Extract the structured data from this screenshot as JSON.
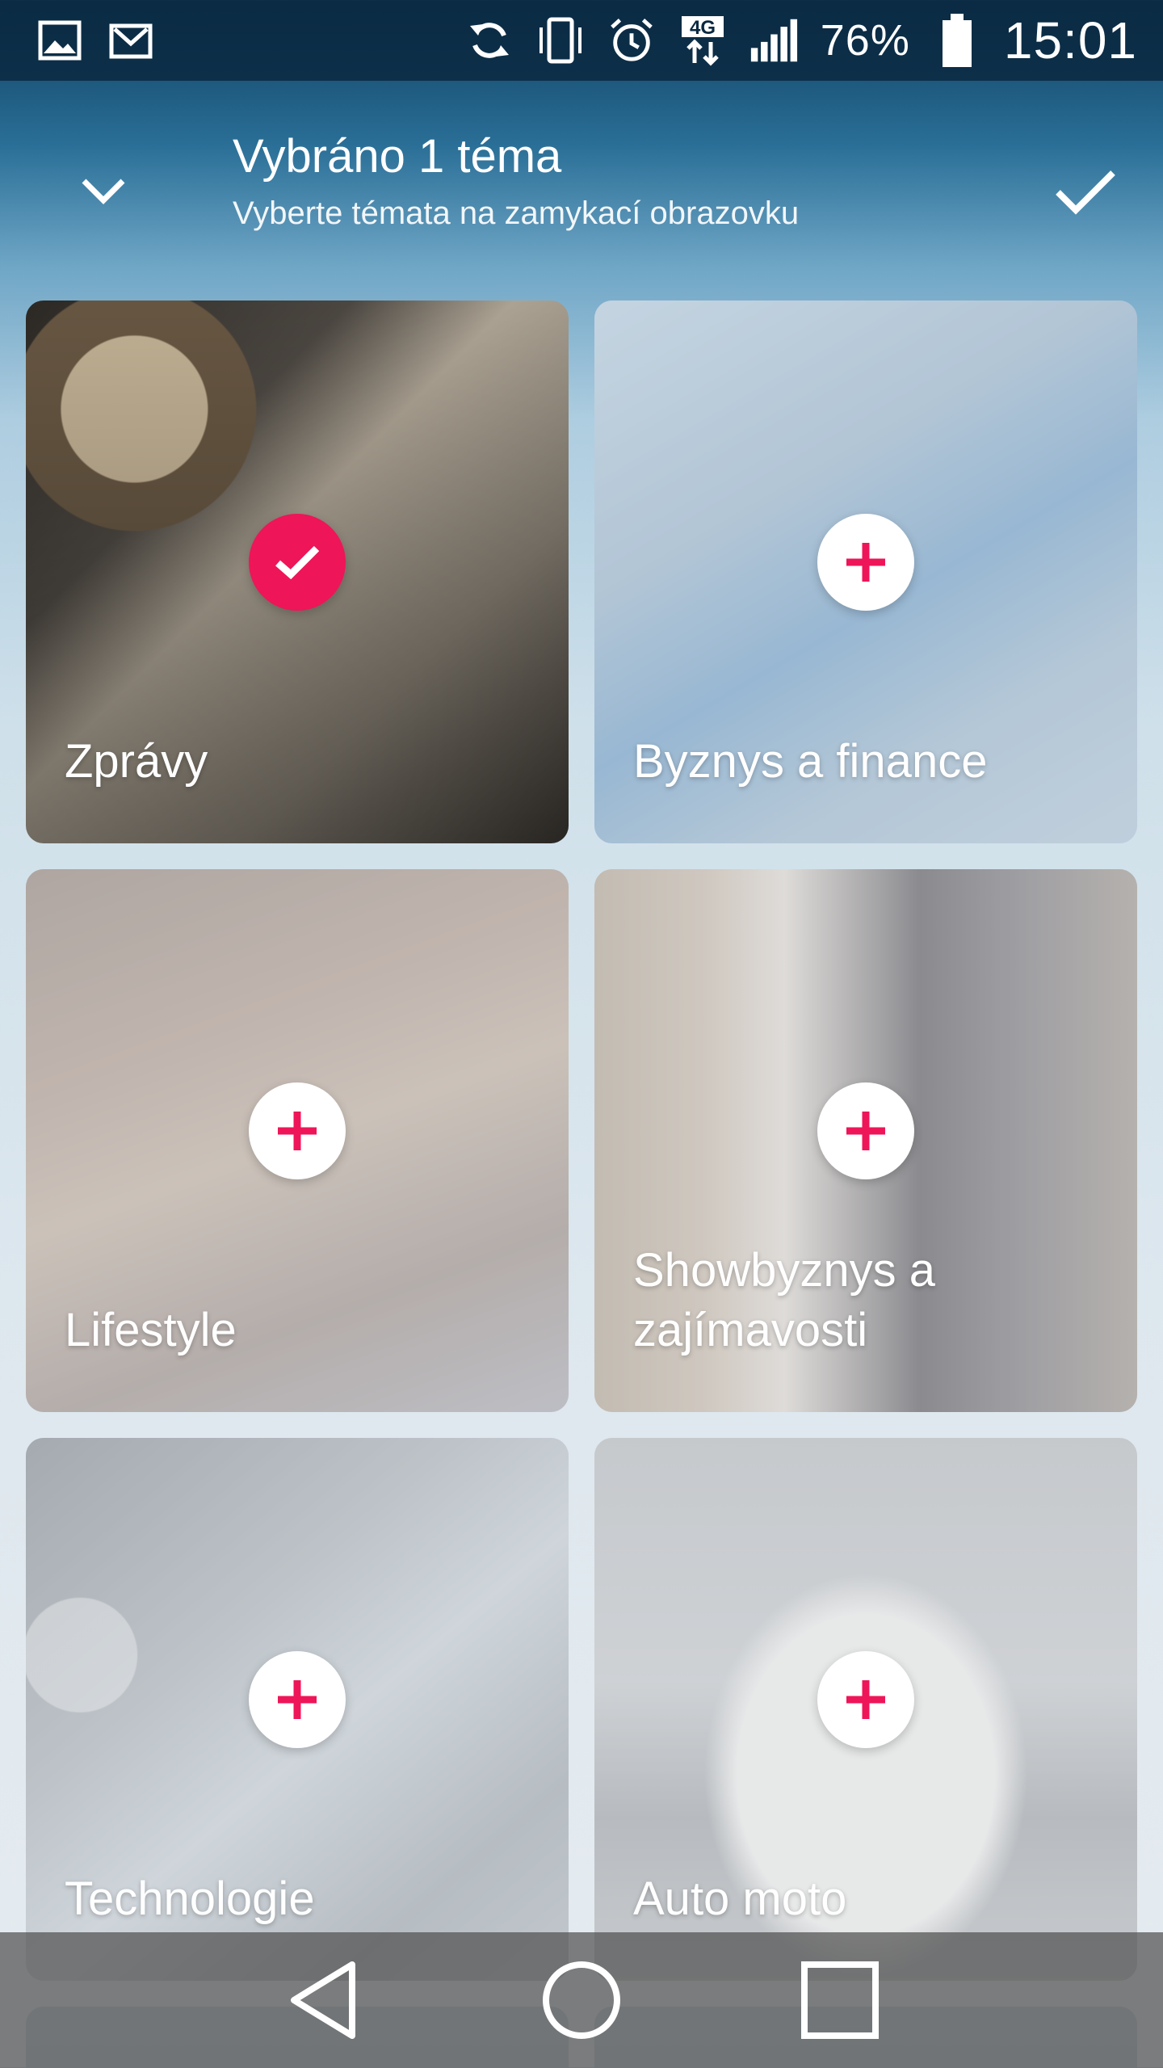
{
  "status_bar": {
    "left_icons": [
      "image-icon",
      "gmail-icon"
    ],
    "right_icons": [
      "sync-icon",
      "vibrate-icon",
      "alarm-icon",
      "4g-data-icon",
      "signal-icon"
    ],
    "network_label": "4G",
    "battery_percent": "76%",
    "time": "15:01"
  },
  "header": {
    "title": "Vybráno 1 téma",
    "subtitle": "Vyberte témata na zamykací obrazovku"
  },
  "topics": [
    {
      "label": "Zprávy",
      "selected": true
    },
    {
      "label": "Byznys a finance",
      "selected": false
    },
    {
      "label": "Lifestyle",
      "selected": false
    },
    {
      "label": "Showbyznys a zajímavosti",
      "selected": false
    },
    {
      "label": "Technologie",
      "selected": false
    },
    {
      "label": "Auto moto",
      "selected": false
    }
  ],
  "colors": {
    "accent": "#ee1558",
    "statusbar": "#0a2840",
    "navbar": "#505050"
  },
  "navigation": {
    "buttons": [
      "back-icon",
      "home-icon",
      "recents-icon"
    ]
  }
}
